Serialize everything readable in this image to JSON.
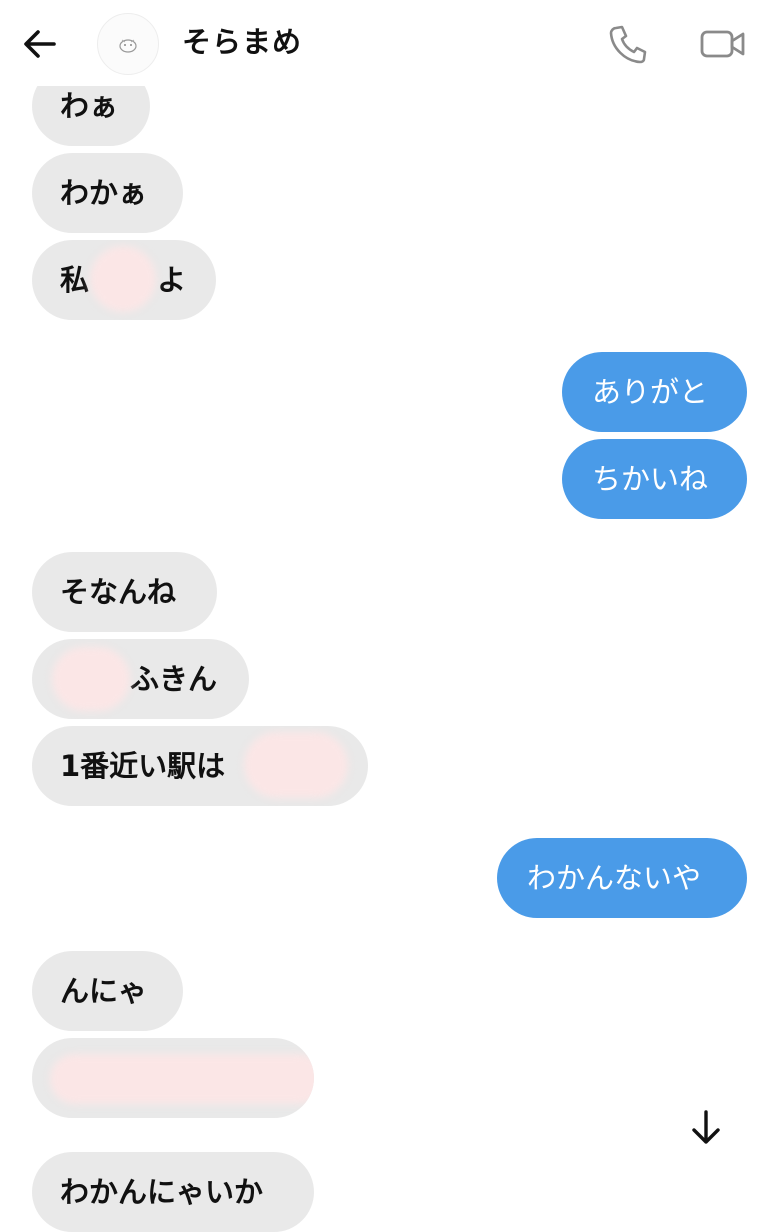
{
  "header": {
    "contact_name": "そらまめ",
    "back_icon": "arrow-left-icon",
    "call_icon": "phone-icon",
    "video_icon": "video-camera-icon"
  },
  "messages": [
    {
      "side": "in",
      "text": "わぁ"
    },
    {
      "side": "in",
      "text": "わかぁ"
    },
    {
      "side": "in",
      "text": "私 　　よ",
      "redacted": true
    },
    {
      "side": "out",
      "text": "ありがと"
    },
    {
      "side": "out",
      "text": "ちかいね"
    },
    {
      "side": "in",
      "text": "そなんね"
    },
    {
      "side": "in",
      "text": "ふきん",
      "redacted": true
    },
    {
      "side": "in",
      "text": "1番近い駅は",
      "redacted": true
    },
    {
      "side": "out",
      "text": "わかんないや"
    },
    {
      "side": "in",
      "text": "んにゃ"
    },
    {
      "side": "in",
      "text": "",
      "redacted": true
    },
    {
      "side": "in",
      "text": "わかんにゃいか"
    }
  ],
  "colors": {
    "incoming_bubble": "#e9e9e9",
    "outgoing_bubble": "#4a9be8",
    "redaction": "#fbe6e6"
  },
  "scroll_down_icon": "arrow-down-icon"
}
